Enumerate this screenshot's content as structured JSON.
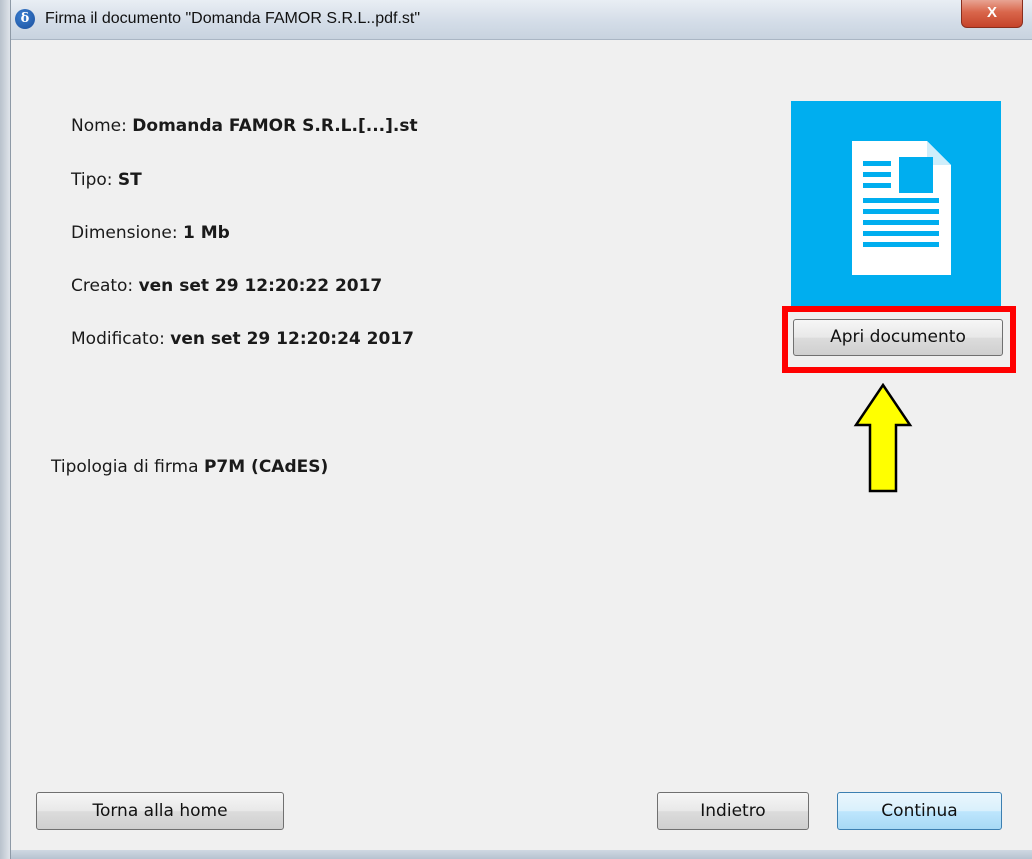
{
  "window": {
    "title": "Firma il documento \"Domanda FAMOR S.R.L..pdf.st\"",
    "close_glyph": "X",
    "app_icon_glyph": "δ"
  },
  "info": {
    "nome_label": "Nome:",
    "nome_value": "Domanda FAMOR S.R.L.[...].st",
    "tipo_label": "Tipo:",
    "tipo_value": "ST",
    "dimensione_label": "Dimensione:",
    "dimensione_value": "1 Mb",
    "creato_label": "Creato:",
    "creato_value": "ven set 29 12:20:22 2017",
    "modificato_label": "Modificato:",
    "modificato_value": "ven set 29 12:20:24 2017"
  },
  "firma": {
    "label": "Tipologia di firma",
    "value": "P7M (CAdES)"
  },
  "preview": {
    "icon": "document-icon",
    "tile_color": "#00aeef",
    "open_button_label": "Apri documento"
  },
  "annotations": {
    "highlight_color": "#ff0000",
    "arrow_color": "#ffff00"
  },
  "footer": {
    "home_label": "Torna alla home",
    "back_label": "Indietro",
    "continue_label": "Continua"
  }
}
